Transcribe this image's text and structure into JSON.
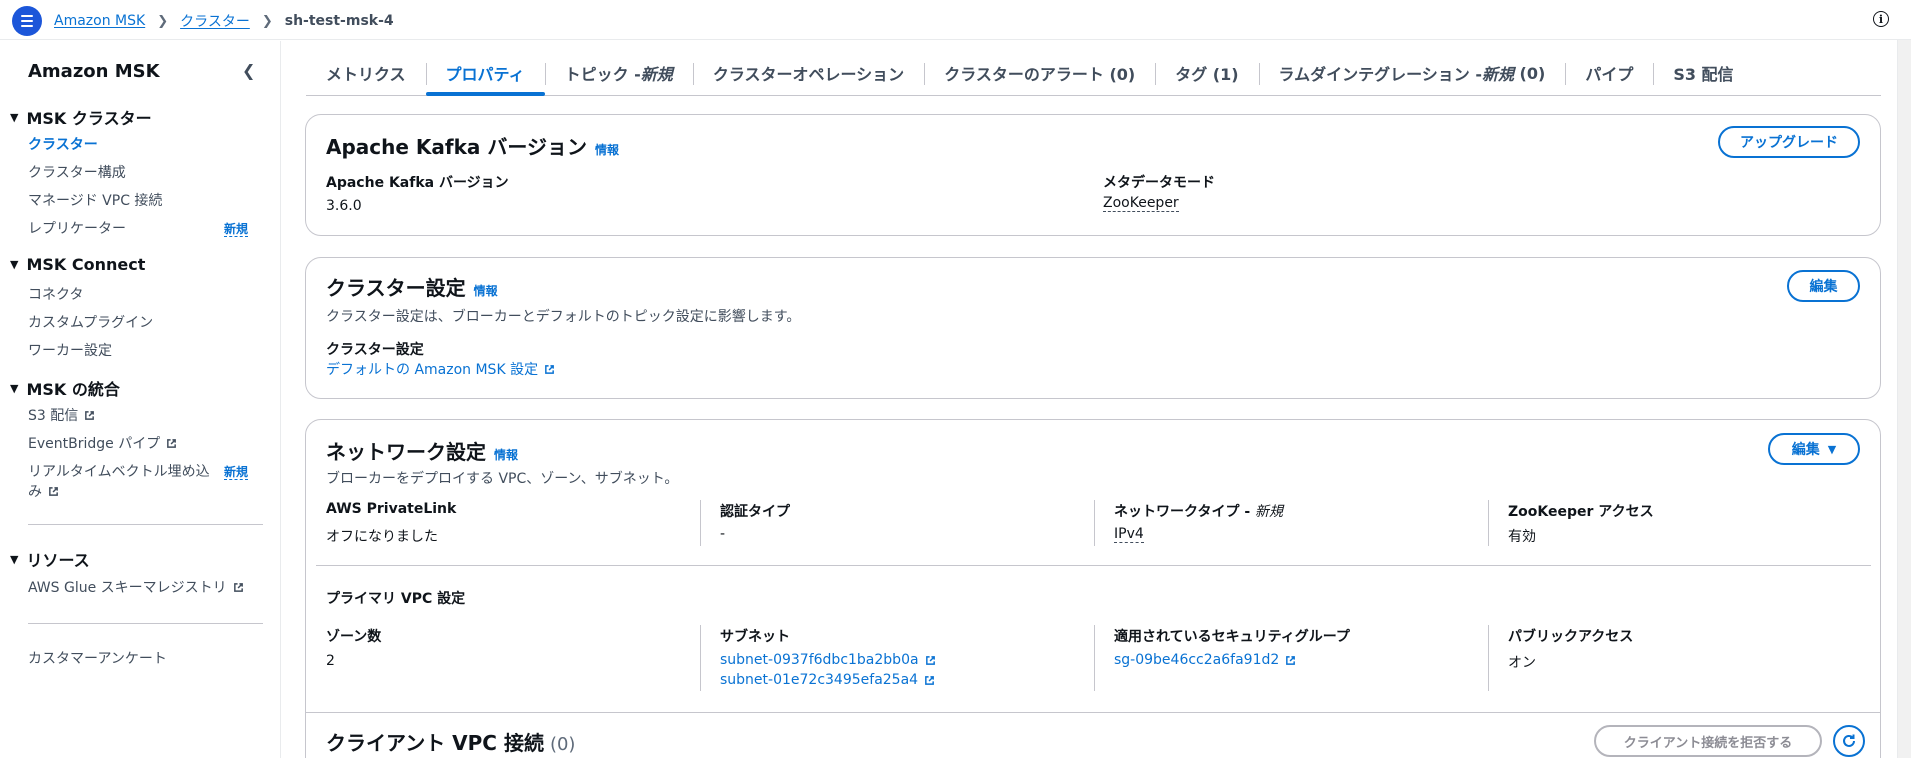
{
  "breadcrumb": {
    "items": [
      "Amazon MSK",
      "クラスター"
    ],
    "current": "sh-test-msk-4"
  },
  "sidebar": {
    "title": "Amazon MSK",
    "sections": [
      {
        "label": "MSK クラスター",
        "items": [
          "クラスター",
          "クラスター構成",
          "マネージド VPC 接続",
          "レプリケーター"
        ]
      },
      {
        "label": "MSK Connect",
        "items": [
          "コネクタ",
          "カスタムプラグイン",
          "ワーカー設定"
        ]
      },
      {
        "label": "MSK の統合",
        "items": [
          "S3 配信",
          "EventBridge パイプ",
          "リアルタイムベクトル埋め込",
          "み"
        ]
      },
      {
        "label": "リソース",
        "items": [
          "AWS Glue スキーマレジストリ"
        ]
      }
    ],
    "new_badge": "新規",
    "survey": "カスタマーアンケート"
  },
  "tabs": [
    {
      "label": "メトリクス"
    },
    {
      "label": "プロパティ"
    },
    {
      "label": "トピック - ",
      "suffix": "新規"
    },
    {
      "label": "クラスターオペレーション"
    },
    {
      "label": "クラスターのアラート (0)"
    },
    {
      "label": "タグ (1)"
    },
    {
      "label": "ラムダインテグレーション - ",
      "suffix": "新規",
      "tail": " (0)"
    },
    {
      "label": "パイプ"
    },
    {
      "label": "S3 配信"
    }
  ],
  "kafka": {
    "title": "Apache Kafka バージョン",
    "info": "情報",
    "button": "アップグレード",
    "version_label": "Apache Kafka バージョン",
    "version_value": "3.6.0",
    "meta_label": "メタデータモード",
    "meta_value": "ZooKeeper"
  },
  "cluster_settings": {
    "title": "クラスター設定",
    "info": "情報",
    "button": "編集",
    "description": "クラスター設定は、ブローカーとデフォルトのトピック設定に影響します。",
    "label": "クラスター設定",
    "link": "デフォルトの Amazon MSK 設定"
  },
  "network": {
    "title": "ネットワーク設定",
    "info": "情報",
    "button": "編集",
    "description": "ブローカーをデプロイする VPC、ゾーン、サブネット。",
    "privatelink_label": "AWS PrivateLink",
    "privatelink_value": "オフになりました",
    "auth_label": "認証タイプ",
    "auth_value": "-",
    "nettype_label": "ネットワークタイプ - ",
    "nettype_suffix": "新規",
    "nettype_value": "IPv4",
    "zk_label": "ZooKeeper アクセス",
    "zk_value": "有効",
    "primary_vpc": "プライマリ VPC 設定",
    "zones_label": "ゾーン数",
    "zones_value": "2",
    "subnet_label": "サブネット",
    "subnets": [
      "subnet-0937f6dbc1ba2bb0a",
      "subnet-01e72c3495efa25a4"
    ],
    "sg_label": "適用されているセキュリティグループ",
    "sg_value": "sg-09be46cc2a6fa91d2",
    "public_label": "パブリックアクセス",
    "public_value": "オン"
  },
  "client_vpc": {
    "title": "クライアント VPC 接続",
    "count": "(0)",
    "button": "クライアント接続を拒否する"
  },
  "colors": {
    "accent": "#0972d3",
    "brand": "#1c56d9",
    "border": "#c6c6cd"
  }
}
